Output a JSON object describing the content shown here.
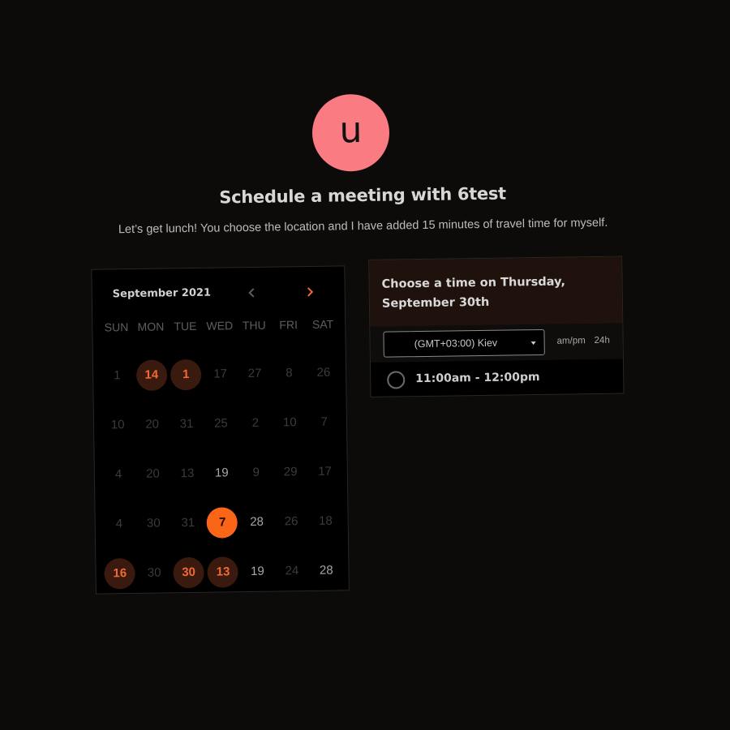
{
  "host": {
    "avatar_letter": "u",
    "avatar_color": "#fb7b83"
  },
  "header": {
    "title": "Schedule a meeting with 6test",
    "description": "Let’s get lunch! You choose the location and I have added 15 minutes of travel time for myself."
  },
  "calendar": {
    "month_label": "September 2021",
    "prev_icon": "chevron-left-icon",
    "next_icon": "chevron-right-icon",
    "weekdays": [
      "SUN",
      "MON",
      "TUE",
      "WED",
      "THU",
      "FRI",
      "SAT"
    ],
    "days": [
      {
        "label": "1",
        "state": "off"
      },
      {
        "label": "14",
        "state": "available"
      },
      {
        "label": "1",
        "state": "available"
      },
      {
        "label": "17",
        "state": "off"
      },
      {
        "label": "27",
        "state": "off"
      },
      {
        "label": "8",
        "state": "off"
      },
      {
        "label": "26",
        "state": "off"
      },
      {
        "label": "10",
        "state": "off"
      },
      {
        "label": "20",
        "state": "off"
      },
      {
        "label": "31",
        "state": "off"
      },
      {
        "label": "25",
        "state": "off"
      },
      {
        "label": "2",
        "state": "off"
      },
      {
        "label": "10",
        "state": "off"
      },
      {
        "label": "7",
        "state": "off"
      },
      {
        "label": "4",
        "state": "off"
      },
      {
        "label": "20",
        "state": "off"
      },
      {
        "label": "13",
        "state": "off"
      },
      {
        "label": "19",
        "state": "on"
      },
      {
        "label": "9",
        "state": "off"
      },
      {
        "label": "29",
        "state": "off"
      },
      {
        "label": "17",
        "state": "off"
      },
      {
        "label": "4",
        "state": "off"
      },
      {
        "label": "30",
        "state": "off"
      },
      {
        "label": "31",
        "state": "off"
      },
      {
        "label": "7",
        "state": "selected"
      },
      {
        "label": "28",
        "state": "on"
      },
      {
        "label": "26",
        "state": "off"
      },
      {
        "label": "18",
        "state": "off"
      },
      {
        "label": "16",
        "state": "available"
      },
      {
        "label": "30",
        "state": "off"
      },
      {
        "label": "30",
        "state": "available"
      },
      {
        "label": "13",
        "state": "available"
      },
      {
        "label": "19",
        "state": "on"
      },
      {
        "label": "24",
        "state": "off"
      },
      {
        "label": "28",
        "state": "on"
      }
    ]
  },
  "times": {
    "heading": "Choose a time on Thursday, September 30th",
    "timezone": "(GMT+03:00) Kiev",
    "format_12h": "am/pm",
    "format_24h": "24h",
    "slots": [
      "11:00am - 12:00pm"
    ]
  },
  "colors": {
    "accent": "#fa6518",
    "available_bg": "#3a1a0e",
    "background": "#0c0b09"
  }
}
